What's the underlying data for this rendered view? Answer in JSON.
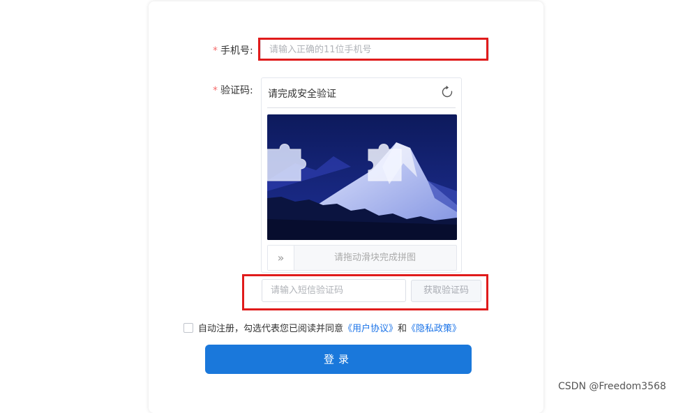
{
  "form": {
    "phone_label": "手机号:",
    "phone_placeholder": "请输入正确的11位手机号",
    "code_label": "验证码:",
    "required_mark": "*",
    "captcha": {
      "title": "请完成安全验证",
      "slider_hint": "请拖动滑块完成拼图",
      "slider_handle": "»"
    },
    "sms_placeholder": "请输入短信验证码",
    "sms_button": "获取验证码",
    "agreement": {
      "text": "自动注册，勾选代表您已阅读并同意",
      "user_agreement": "《用户协议》",
      "and": "和",
      "privacy_policy": "《隐私政策》"
    },
    "login_button": "登录"
  },
  "watermark": "CSDN @Freedom3568",
  "colors": {
    "required": "#f56c6c",
    "highlight_box": "#e01b1b",
    "link": "#1a73e8",
    "primary_button": "#1a78db"
  }
}
